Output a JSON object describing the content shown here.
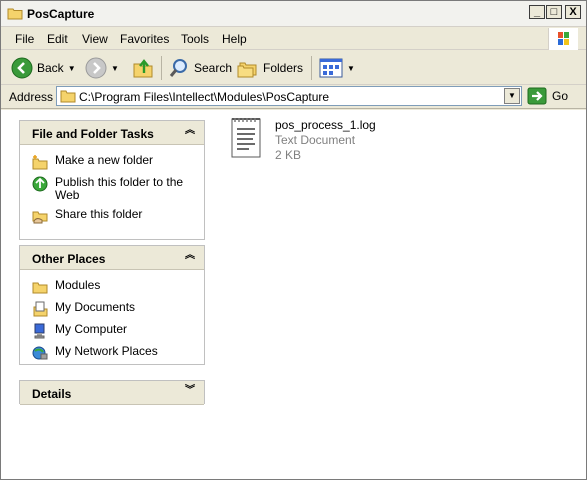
{
  "window": {
    "title": "PosCapture",
    "controls": {
      "minimize": "_",
      "maximize": "□",
      "close": "X"
    }
  },
  "menu": {
    "items": [
      "File",
      "Edit",
      "View",
      "Favorites",
      "Tools",
      "Help"
    ]
  },
  "toolbar": {
    "back_label": "Back",
    "search_label": "Search",
    "folders_label": "Folders"
  },
  "address": {
    "label": "Address",
    "value": "C:\\Program Files\\Intellect\\Modules\\PosCapture",
    "go_label": "Go"
  },
  "panels": {
    "file_tasks": {
      "title": "File and Folder Tasks",
      "links": [
        {
          "label": "Make a new folder",
          "icon": "new-folder-icon"
        },
        {
          "label": "Publish this folder to the Web",
          "icon": "globe-publish-icon"
        },
        {
          "label": "Share this folder",
          "icon": "share-folder-icon"
        }
      ]
    },
    "other_places": {
      "title": "Other Places",
      "links": [
        {
          "label": "Modules",
          "icon": "folder-icon"
        },
        {
          "label": "My Documents",
          "icon": "documents-icon"
        },
        {
          "label": "My Computer",
          "icon": "computer-icon"
        },
        {
          "label": "My Network Places",
          "icon": "network-icon"
        }
      ]
    },
    "details": {
      "title": "Details"
    }
  },
  "files": [
    {
      "name": "pos_process_1.log",
      "type": "Text Document",
      "size": "2 KB",
      "icon": "text-document-icon"
    }
  ],
  "colors": {
    "panel_header": "#ece9d8",
    "go_arrow": "#3a9a3a",
    "back_arrow": "#3a9a3a",
    "folder_yellow": "#f5d36b"
  }
}
